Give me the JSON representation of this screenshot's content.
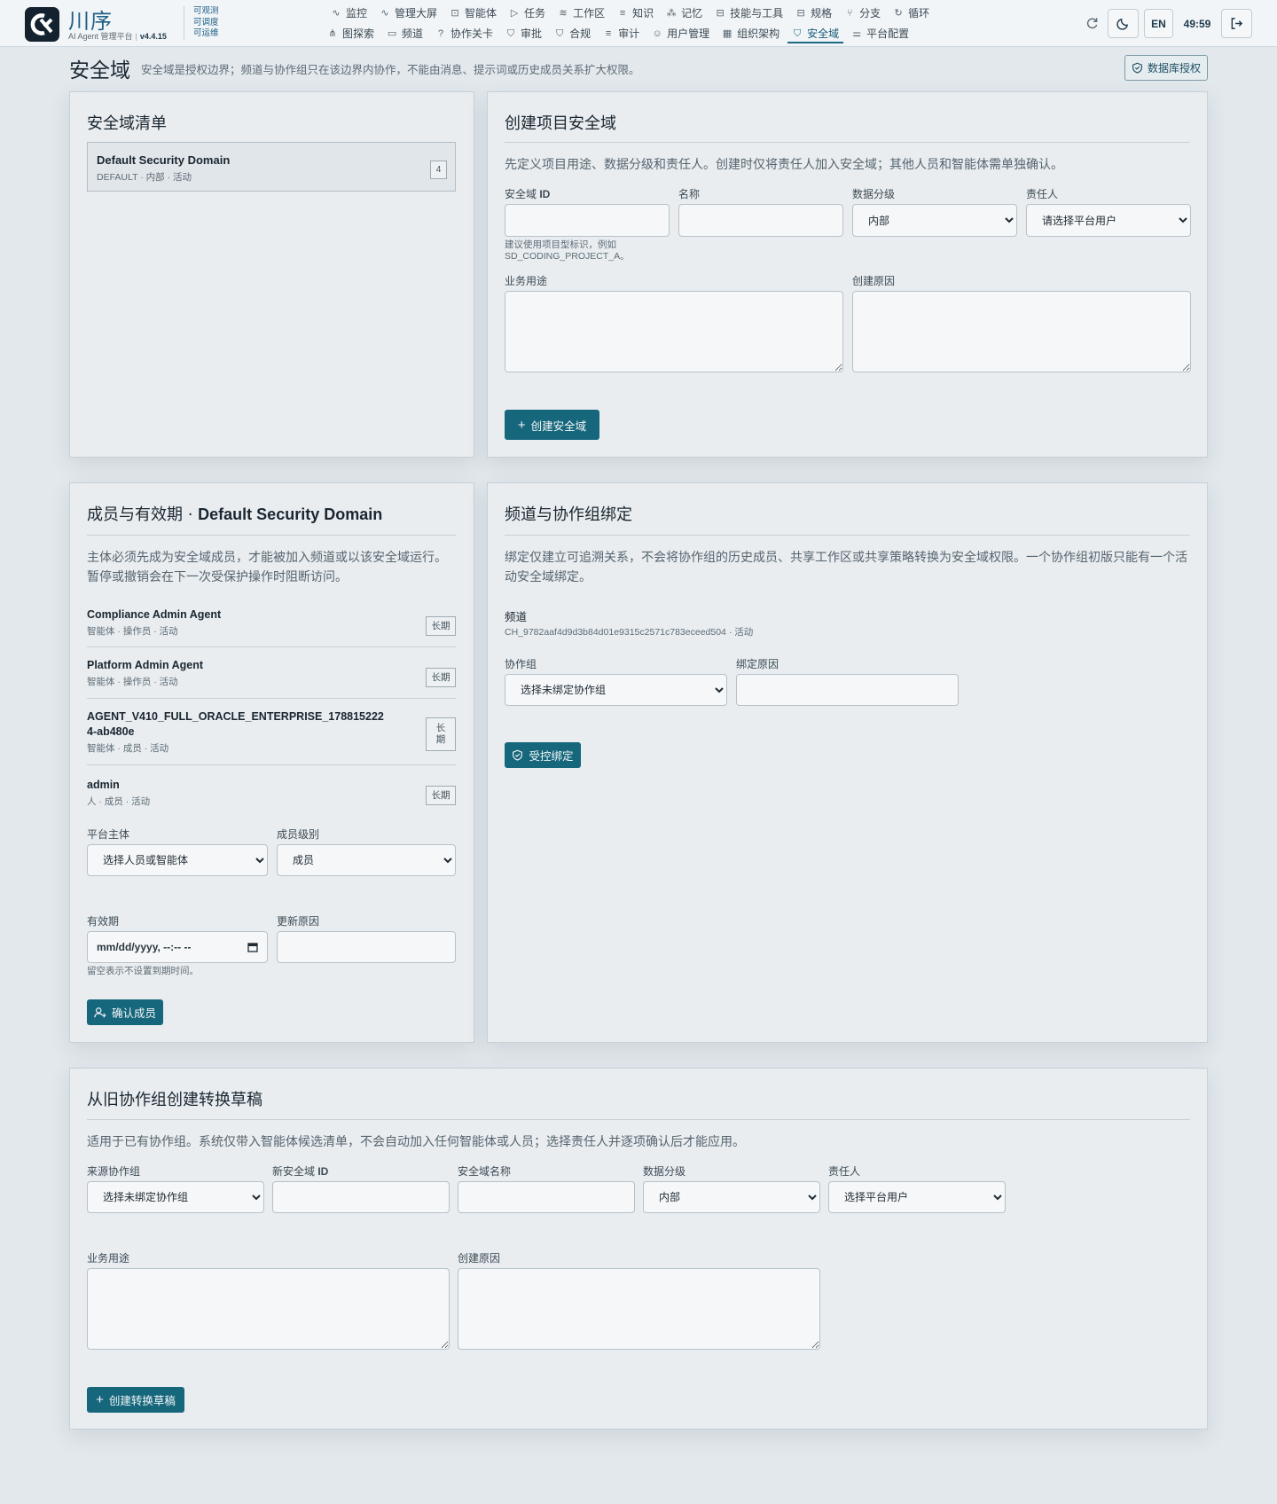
{
  "brand": {
    "name": "川序",
    "product": "AI Agent 管理平台",
    "version": "v4.4.15",
    "tags": [
      "可观测",
      "可调度",
      "可运维"
    ]
  },
  "nav": {
    "row1": [
      {
        "label": "监控",
        "icon": "pulse-icon"
      },
      {
        "label": "管理大屏",
        "icon": "pulse-icon"
      },
      {
        "label": "智能体",
        "icon": "bot-icon"
      },
      {
        "label": "任务",
        "icon": "play-circle-icon"
      },
      {
        "label": "工作区",
        "icon": "layers-icon"
      },
      {
        "label": "知识",
        "icon": "database-icon"
      },
      {
        "label": "记忆",
        "icon": "nodes-icon"
      },
      {
        "label": "技能与工具",
        "icon": "file-code-icon"
      },
      {
        "label": "规格",
        "icon": "file-code-icon"
      },
      {
        "label": "分支",
        "icon": "branch-icon"
      },
      {
        "label": "循环",
        "icon": "refresh-icon"
      }
    ],
    "row2": [
      {
        "label": "图探索",
        "icon": "graph-icon"
      },
      {
        "label": "频道",
        "icon": "chat-icon"
      },
      {
        "label": "协作关卡",
        "icon": "help-circle-icon"
      },
      {
        "label": "审批",
        "icon": "shield-check-icon"
      },
      {
        "label": "合规",
        "icon": "shield-check-icon"
      },
      {
        "label": "审计",
        "icon": "database-icon"
      },
      {
        "label": "用户管理",
        "icon": "users-icon"
      },
      {
        "label": "组织架构",
        "icon": "building-icon"
      },
      {
        "label": "安全域",
        "icon": "shield-check-icon",
        "active": true
      },
      {
        "label": "平台配置",
        "icon": "sliders-icon"
      }
    ]
  },
  "toolbar": {
    "lang": "EN",
    "timer": "49:59"
  },
  "page": {
    "title": "安全域",
    "description": "安全域是授权边界；频道与协作组只在该边界内协作，不能由消息、提示词或历史成员关系扩大权限。",
    "db_auth_label": "数据库授权"
  },
  "domain_list": {
    "title": "安全域清单",
    "items": [
      {
        "name": "Default Security Domain",
        "meta": "DEFAULT · 内部 · 活动",
        "count": "4"
      }
    ]
  },
  "create_domain": {
    "title": "创建项目安全域",
    "description": "先定义项目用途、数据分级和责任人。创建时仅将责任人加入安全域；其他人员和智能体需单独确认。",
    "id_label_prefix": "安全域 ",
    "id_label_bold": "ID",
    "name_label": "名称",
    "classification_label": "数据分级",
    "classification_value": "内部",
    "owner_label": "责任人",
    "owner_placeholder": "请选择平台用户",
    "id_hint_1": "建议使用项目型标识，例如",
    "id_hint_2": "SD_CODING_PROJECT_A。",
    "purpose_label": "业务用途",
    "reason_label": "创建原因",
    "submit_label": "创建安全域"
  },
  "members": {
    "title_prefix": "成员与有效期 · ",
    "title_domain": "Default Security Domain",
    "description": "主体必须先成为安全域成员，才能被加入频道或以该安全域运行。暂停或撤销会在下一次受保护操作时阻断访问。",
    "items": [
      {
        "name": "Compliance Admin Agent",
        "meta": "智能体 · 操作员 · 活动",
        "term": "长期"
      },
      {
        "name": "Platform Admin Agent",
        "meta": "智能体 · 操作员 · 活动",
        "term": "长期"
      },
      {
        "name": "AGENT_V410_FULL_ORACLE_ENTERPRISE_1788152224-ab480e",
        "meta": "智能体 · 成员 · 活动",
        "term": "长期"
      },
      {
        "name": "admin",
        "meta": "人 · 成员 · 活动",
        "term": "长期"
      }
    ],
    "principal_label": "平台主体",
    "principal_placeholder": "选择人员或智能体",
    "level_label": "成员级别",
    "level_value": "成员",
    "expiry_label": "有效期",
    "expiry_placeholder": "mm/dd/yyyy, --:-- --",
    "update_reason_label": "更新原因",
    "expiry_hint": "留空表示不设置到期时间。",
    "submit_label": "确认成员"
  },
  "binding": {
    "title": "频道与协作组绑定",
    "description": "绑定仅建立可追溯关系，不会将协作组的历史成员、共享工作区或共享策略转换为安全域权限。一个协作组初版只能有一个活动安全域绑定。",
    "channel_label": "频道",
    "channel_meta": "CH_9782aaf4d9d3b84d01e9315c2571c783eceed504 · 活动",
    "group_label": "协作组",
    "group_placeholder": "选择未绑定协作组",
    "reason_label": "绑定原因",
    "submit_label": "受控绑定"
  },
  "conversion": {
    "title": "从旧协作组创建转换草稿",
    "description": "适用于已有协作组。系统仅带入智能体候选清单，不会自动加入任何智能体或人员；选择责任人并逐项确认后才能应用。",
    "source_label": "来源协作组",
    "source_placeholder": "选择未绑定协作组",
    "new_id_label_prefix": "新安全域 ",
    "new_id_label_bold": "ID",
    "name_label": "安全域名称",
    "classification_label": "数据分级",
    "classification_value": "内部",
    "owner_label": "责任人",
    "owner_placeholder": "选择平台用户",
    "purpose_label": "业务用途",
    "reason_label": "创建原因",
    "submit_label": "创建转换草稿"
  },
  "colors": {
    "accent": "#17677c",
    "brand": "#1f5f86",
    "background": "#e2e8ec"
  }
}
